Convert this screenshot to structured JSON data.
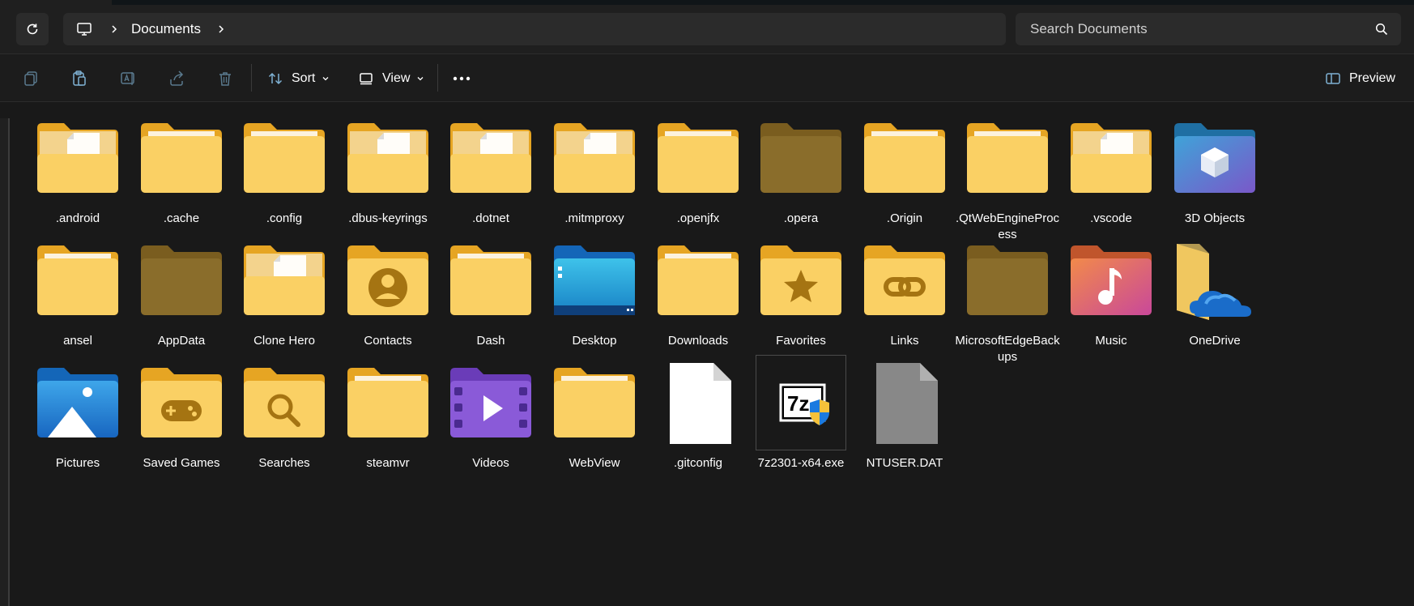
{
  "address": {
    "crumb": "Documents"
  },
  "search": {
    "placeholder": "Search Documents"
  },
  "toolbar": {
    "sort_label": "Sort",
    "view_label": "View",
    "preview_label": "Preview"
  },
  "colors": {
    "background": "#191919",
    "folder_yellow": "#f6c84d",
    "folder_dark": "#8a6d2b"
  },
  "items": [
    {
      "name": ".android",
      "icon": "folder-with-file-icon"
    },
    {
      "name": ".cache",
      "icon": "folder-icon"
    },
    {
      "name": ".config",
      "icon": "folder-icon"
    },
    {
      "name": ".dbus-keyrings",
      "icon": "folder-with-file-icon"
    },
    {
      "name": ".dotnet",
      "icon": "folder-with-file-icon"
    },
    {
      "name": ".mitmproxy",
      "icon": "folder-with-file-icon"
    },
    {
      "name": ".openjfx",
      "icon": "folder-icon"
    },
    {
      "name": ".opera",
      "icon": "folder-hidden-icon"
    },
    {
      "name": ".Origin",
      "icon": "folder-icon"
    },
    {
      "name": ".QtWebEngineProcess",
      "icon": "folder-icon"
    },
    {
      "name": ".vscode",
      "icon": "folder-with-file-icon"
    },
    {
      "name": "3D Objects",
      "icon": "3d-objects-folder-icon"
    },
    {
      "name": "ansel",
      "icon": "folder-icon"
    },
    {
      "name": "AppData",
      "icon": "folder-hidden-icon"
    },
    {
      "name": "Clone Hero",
      "icon": "folder-with-file-icon"
    },
    {
      "name": "Contacts",
      "icon": "contacts-folder-icon"
    },
    {
      "name": "Dash",
      "icon": "folder-icon"
    },
    {
      "name": "Desktop",
      "icon": "desktop-folder-icon"
    },
    {
      "name": "Downloads",
      "icon": "folder-icon"
    },
    {
      "name": "Favorites",
      "icon": "favorites-folder-icon"
    },
    {
      "name": "Links",
      "icon": "links-folder-icon"
    },
    {
      "name": "MicrosoftEdgeBackups",
      "icon": "folder-hidden-icon"
    },
    {
      "name": "Music",
      "icon": "music-folder-icon"
    },
    {
      "name": "OneDrive",
      "icon": "onedrive-folder-icon"
    },
    {
      "name": "Pictures",
      "icon": "pictures-folder-icon"
    },
    {
      "name": "Saved Games",
      "icon": "saved-games-folder-icon"
    },
    {
      "name": "Searches",
      "icon": "searches-folder-icon"
    },
    {
      "name": "steamvr",
      "icon": "folder-icon"
    },
    {
      "name": "Videos",
      "icon": "videos-folder-icon"
    },
    {
      "name": "WebView",
      "icon": "folder-icon"
    },
    {
      "name": ".gitconfig",
      "icon": "blank-file-icon"
    },
    {
      "name": "7z2301-x64.exe",
      "icon": "7zip-installer-icon"
    },
    {
      "name": "NTUSER.DAT",
      "icon": "system-file-icon"
    }
  ]
}
